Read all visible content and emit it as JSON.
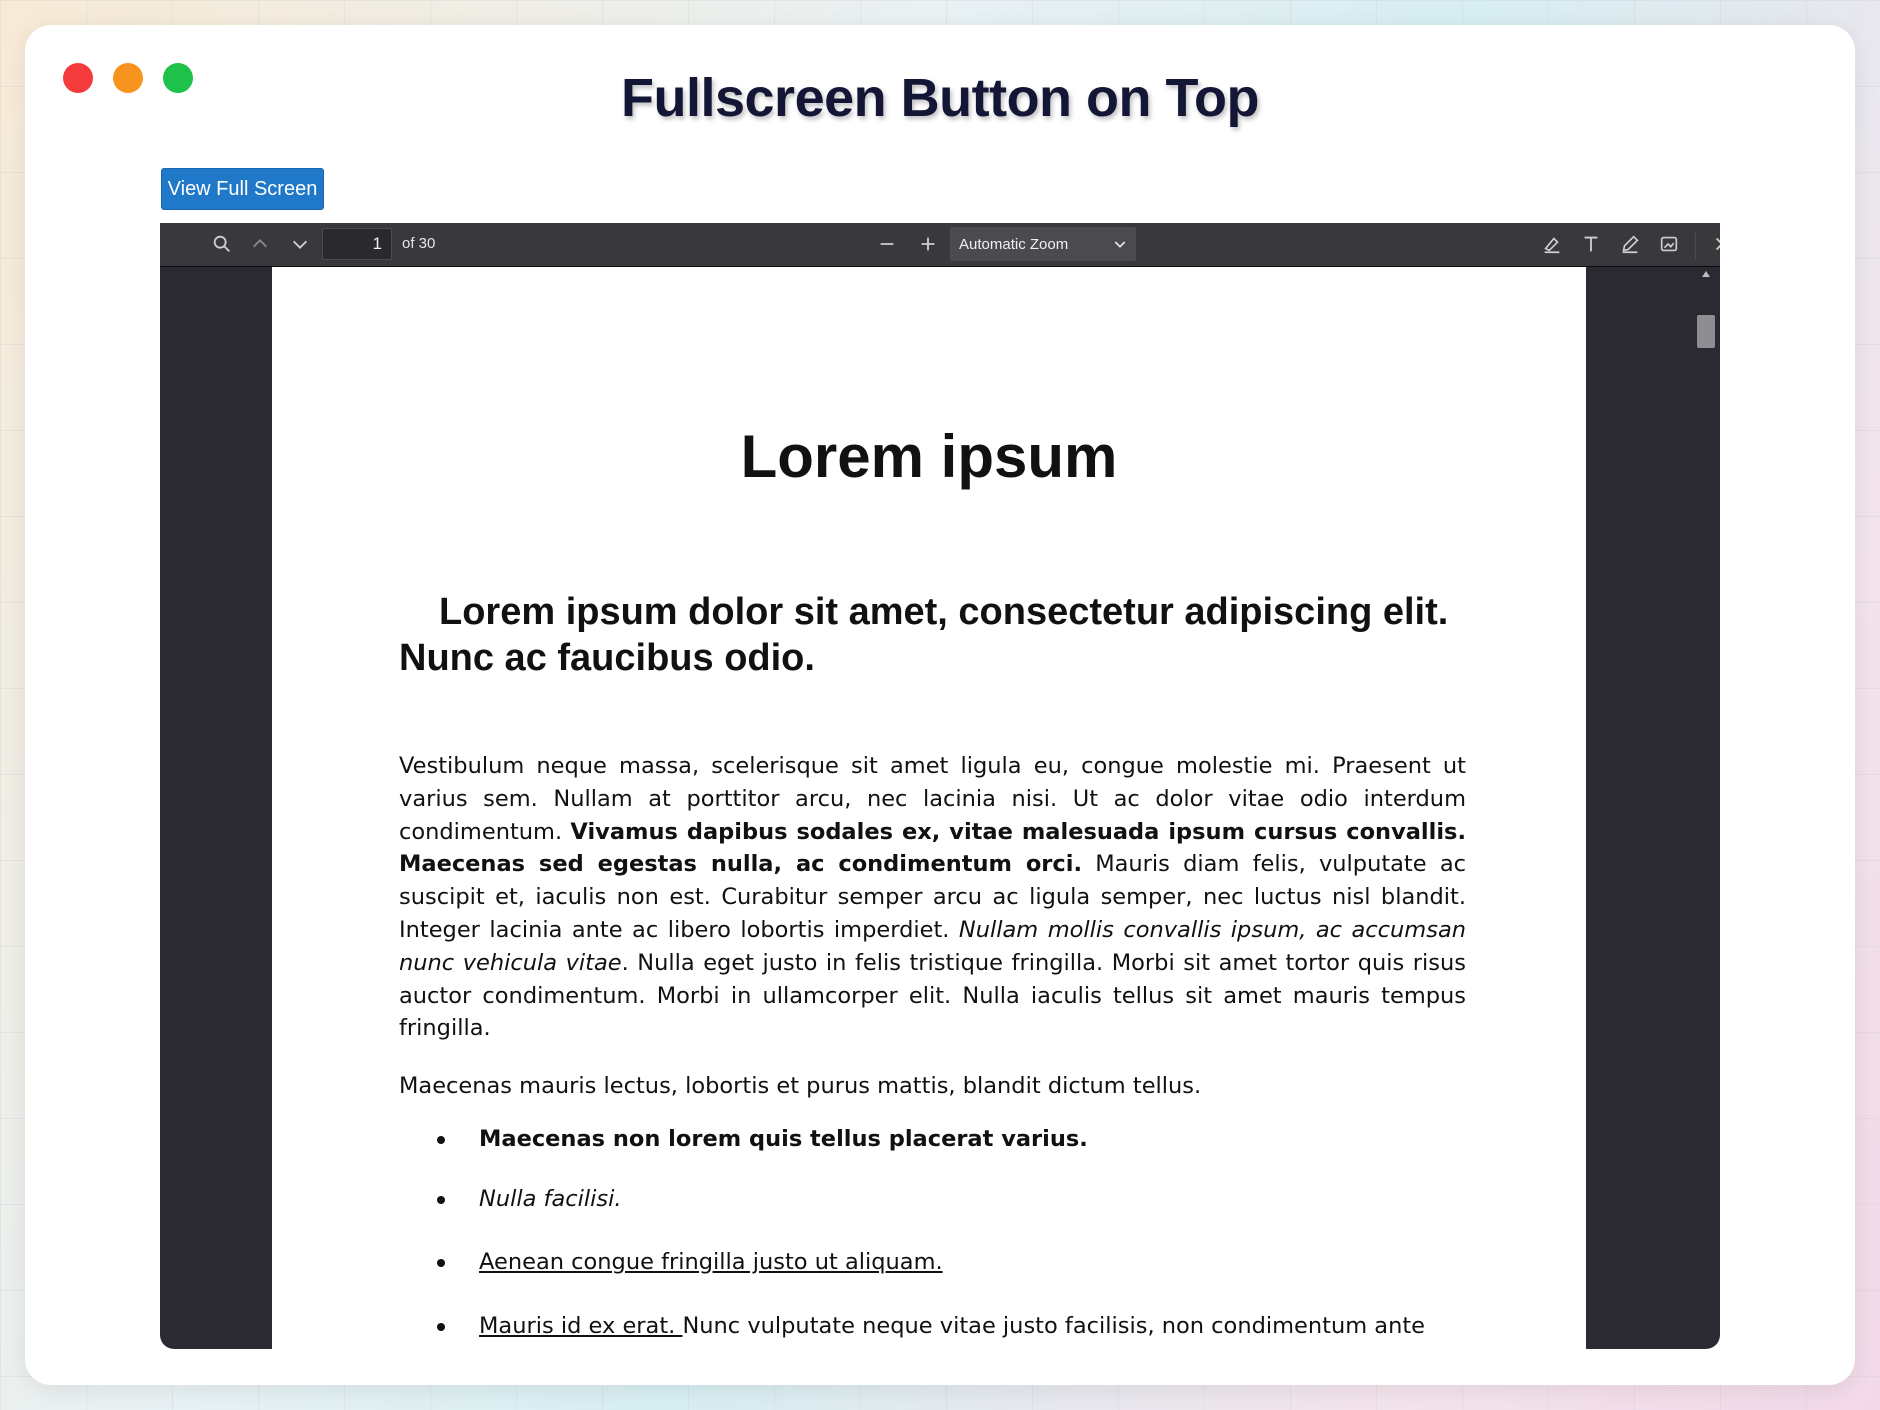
{
  "window": {
    "title": "Fullscreen Button on Top",
    "controls": [
      "close",
      "minimize",
      "maximize"
    ]
  },
  "fullscreen_button": {
    "label": "View Full Screen",
    "color": "#1f78c8"
  },
  "viewer": {
    "toolbar": {
      "page_number": "1",
      "page_count": "of 30",
      "zoom": "Automatic Zoom",
      "icons": {
        "search": "search-icon",
        "prev": "chevron-up-icon",
        "next": "chevron-down-icon",
        "zoom_out": "minus-icon",
        "zoom_in": "plus-icon",
        "highlight": "highlighter-icon",
        "text": "text-icon",
        "draw": "pen-icon",
        "image": "image-icon",
        "more": "double-chevron-right-icon"
      }
    },
    "document": {
      "title": "Lorem ipsum",
      "heading": "Lorem ipsum dolor sit amet, consectetur adipiscing elit. Nunc ac faucibus odio.",
      "paragraph1": {
        "s1": "Vestibulum neque massa, scelerisque sit amet ligula eu, congue molestie mi. Praesent ut varius sem. Nullam at porttitor arcu, nec lacinia nisi. Ut ac dolor vitae odio interdum condimentum. ",
        "s2_bold": "Vivamus dapibus sodales ex, vitae malesuada ipsum cursus convallis. Maecenas sed egestas nulla, ac condimentum orci.",
        "s3": " Mauris diam felis, vulputate ac suscipit et, iaculis non est. Curabitur semper arcu ac ligula semper, nec luctus nisl blandit. Integer lacinia ante ac libero lobortis imperdiet. ",
        "s4_italic": "Nullam mollis convallis ipsum, ac accumsan nunc vehicula vitae",
        "s5": ". Nulla eget justo in felis tristique fringilla. Morbi sit amet tortor quis risus auctor condimentum. Morbi in ullamcorper elit. Nulla iaculis tellus sit amet mauris tempus fringilla."
      },
      "paragraph2": "Maecenas mauris lectus, lobortis et purus mattis, blandit dictum tellus.",
      "bullets": {
        "b1_bold": "Maecenas non lorem quis tellus placerat varius.",
        "b2_italic": "Nulla facilisi.",
        "b3_underline": "Aenean congue fringilla justo ut aliquam. ",
        "b4_underline": "Mauris id ex erat. ",
        "b4_rest": "Nunc vulputate neque vitae justo facilisis, non condimentum ante"
      }
    }
  }
}
